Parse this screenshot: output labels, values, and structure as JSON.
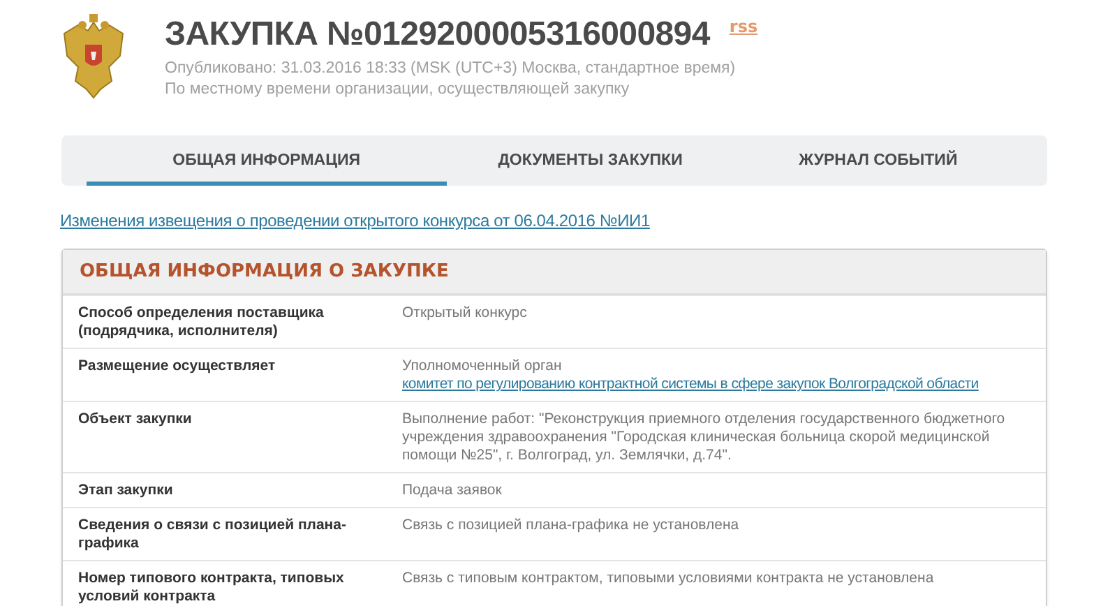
{
  "header": {
    "title": "ЗАКУПКА №0129200005316000894",
    "rss": "rss",
    "published": "Опубликовано: 31.03.2016 18:33 (MSK (UTC+3) Москва, стандартное время)",
    "note": "По местному времени организации, осуществляющей закупку"
  },
  "tabs": [
    {
      "label": "ОБЩАЯ ИНФОРМАЦИЯ",
      "selected": true
    },
    {
      "label": "ДОКУМЕНТЫ ЗАКУПКИ",
      "selected": false
    },
    {
      "label": "ЖУРНАЛ СОБЫТИЙ",
      "selected": false
    }
  ],
  "change_link": "Изменения извещения о проведении открытого конкурса от 06.04.2016 №ИИ1",
  "card": {
    "title": "ОБЩАЯ ИНФОРМАЦИЯ О ЗАКУПКЕ",
    "rows": [
      {
        "label": "Способ определения поставщика (подрядчика, исполнителя)",
        "values": [
          {
            "kind": "text",
            "text": "Открытый конкурс"
          }
        ]
      },
      {
        "label": "Размещение осуществляет",
        "values": [
          {
            "kind": "text",
            "text": "Уполномоченный орган"
          },
          {
            "kind": "link",
            "text": "комитет по регулированию контрактной системы в сфере закупок Волгоградской области"
          }
        ]
      },
      {
        "label": "Объект закупки",
        "values": [
          {
            "kind": "text",
            "text": "Выполнение работ: \"Реконструкция приемного отделения государственного бюджетного учреждения здравоохранения \"Городская клиническая больница скорой медицинской помощи №25\", г. Волгоград, ул. Землячки, д.74\"."
          }
        ]
      },
      {
        "label": "Этап закупки",
        "values": [
          {
            "kind": "text",
            "text": "Подача заявок"
          }
        ]
      },
      {
        "label": "Сведения о связи с позицией плана-графика",
        "values": [
          {
            "kind": "text",
            "text": "Связь с позицией плана-графика не установлена"
          }
        ]
      },
      {
        "label": "Номер типового контракта, типовых условий контракта",
        "values": [
          {
            "kind": "text",
            "text": "Связь с типовым контрактом, типовыми условиями контракта не установлена"
          }
        ]
      }
    ]
  }
}
